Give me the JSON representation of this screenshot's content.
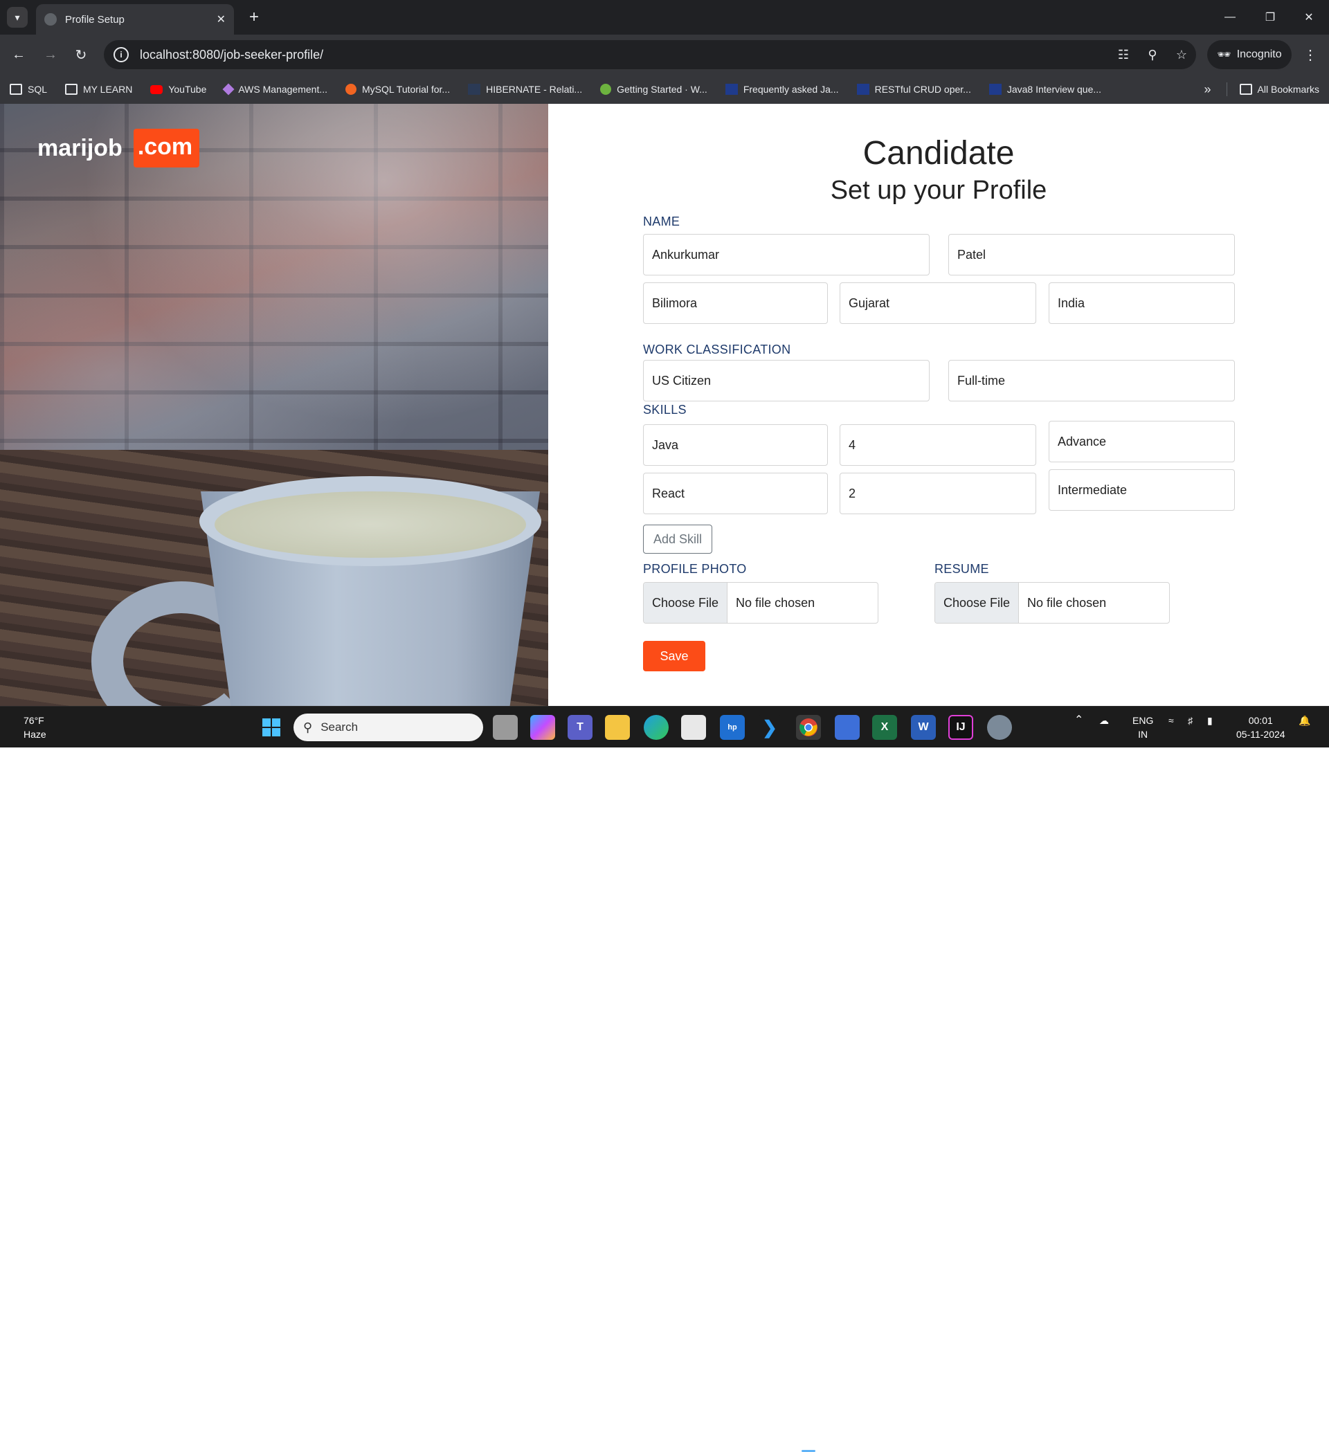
{
  "browser": {
    "tab_title": "Profile Setup",
    "url": "localhost:8080/job-seeker-profile/",
    "incognito_label": "Incognito",
    "bookmarks": [
      {
        "label": "SQL",
        "icon": "folder-icon"
      },
      {
        "label": "MY LEARN",
        "icon": "folder-icon"
      },
      {
        "label": "YouTube",
        "icon": "youtube-icon"
      },
      {
        "label": "AWS Management...",
        "icon": "aws-icon"
      },
      {
        "label": "MySQL Tutorial for...",
        "icon": "mysql-icon"
      },
      {
        "label": "HIBERNATE - Relati...",
        "icon": "site-icon"
      },
      {
        "label": "Getting Started · W...",
        "icon": "spring-icon"
      },
      {
        "label": "Frequently asked Ja...",
        "icon": "site-icon"
      },
      {
        "label": "RESTful CRUD oper...",
        "icon": "site-icon"
      },
      {
        "label": "Java8 Interview que...",
        "icon": "site-icon"
      }
    ],
    "all_bookmarks": "All Bookmarks"
  },
  "logo": {
    "main": "marijob",
    "suffix": ".com"
  },
  "form": {
    "heading": "Candidate",
    "subheading": "Set up your Profile",
    "name_label": "NAME",
    "first_name": "Ankurkumar",
    "last_name": "Patel",
    "city": "Bilimora",
    "state": "Gujarat",
    "country": "India",
    "work_label": "WORK CLASSIFICATION",
    "work_authorization": "US Citizen",
    "employment_type": "Full-time",
    "skills_label": "SKILLS",
    "skills": [
      {
        "name": "Java",
        "years": "4",
        "level": "Advance"
      },
      {
        "name": "React",
        "years": "2",
        "level": "Intermediate"
      }
    ],
    "add_skill": "Add Skill",
    "photo_label": "PROFILE PHOTO",
    "resume_label": "RESUME",
    "choose_file": "Choose File",
    "no_file": "No file chosen",
    "save": "Save"
  },
  "taskbar": {
    "temperature": "76°F",
    "weather": "Haze",
    "search": "Search",
    "lang_top": "ENG",
    "lang_bottom": "IN",
    "time": "00:01",
    "date": "05-11-2024"
  },
  "colors": {
    "brand": "#fc4c17",
    "label": "#1e3a6b"
  }
}
